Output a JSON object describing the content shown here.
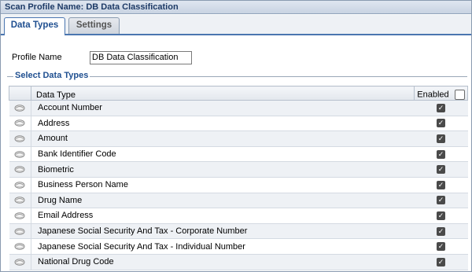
{
  "window": {
    "title": "Scan Profile Name: DB Data Classification"
  },
  "tabs": [
    {
      "label": "Data Types",
      "active": true
    },
    {
      "label": "Settings",
      "active": false
    }
  ],
  "profile": {
    "label": "Profile Name",
    "value": "DB Data Classification"
  },
  "section": {
    "legend": "Select Data Types"
  },
  "table": {
    "columns": {
      "data_type": "Data Type",
      "enabled": "Enabled"
    },
    "header_checkbox_checked": false,
    "rows": [
      {
        "name": "Account Number",
        "enabled": true
      },
      {
        "name": "Address",
        "enabled": true
      },
      {
        "name": "Amount",
        "enabled": true
      },
      {
        "name": "Bank Identifier Code",
        "enabled": true
      },
      {
        "name": "Biometric",
        "enabled": true
      },
      {
        "name": "Business Person Name",
        "enabled": true
      },
      {
        "name": "Drug Name",
        "enabled": true
      },
      {
        "name": "Email Address",
        "enabled": true
      },
      {
        "name": "Japanese Social Security And Tax - Corporate Number",
        "enabled": true
      },
      {
        "name": "Japanese Social Security And Tax - Individual Number",
        "enabled": true
      },
      {
        "name": "National Drug Code",
        "enabled": true
      }
    ],
    "row_icon": "eye-icon",
    "check_glyph": "✓"
  },
  "colors": {
    "accent": "#1f4f90",
    "tab_border": "#4b76b0",
    "checkbox": "#4a4a4a"
  }
}
